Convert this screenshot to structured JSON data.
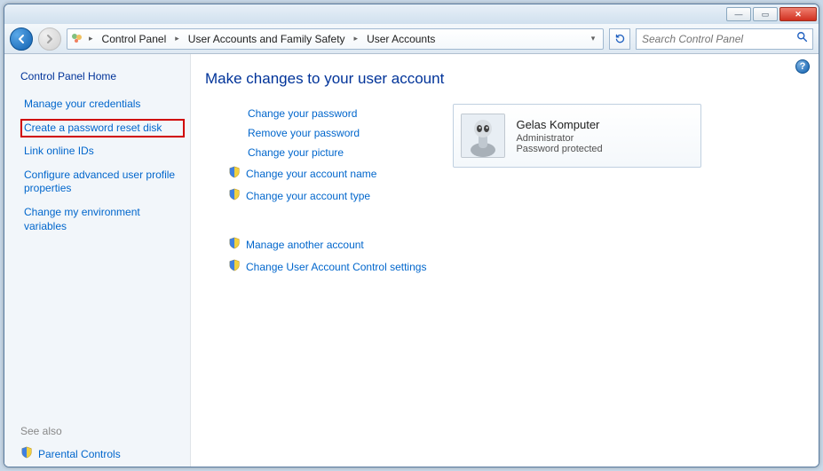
{
  "titlebar": {
    "min": "—",
    "max": "▭",
    "close": "✕"
  },
  "breadcrumbs": [
    "Control Panel",
    "User Accounts and Family Safety",
    "User Accounts"
  ],
  "search": {
    "placeholder": "Search Control Panel"
  },
  "leftpane": {
    "home": "Control Panel Home",
    "tasks": [
      "Manage your credentials",
      "Create a password reset disk",
      "Link online IDs",
      "Configure advanced user profile properties",
      "Change my environment variables"
    ],
    "seealso_label": "See also",
    "seealso_item": "Parental Controls"
  },
  "main": {
    "heading": "Make changes to your user account",
    "actions_plain": [
      "Change your password",
      "Remove your password",
      "Change your picture"
    ],
    "actions_shield": [
      "Change your account name",
      "Change your account type"
    ],
    "actions_shield2": [
      "Manage another account",
      "Change User Account Control settings"
    ],
    "user": {
      "name": "Gelas Komputer",
      "role": "Administrator",
      "status": "Password protected"
    }
  }
}
